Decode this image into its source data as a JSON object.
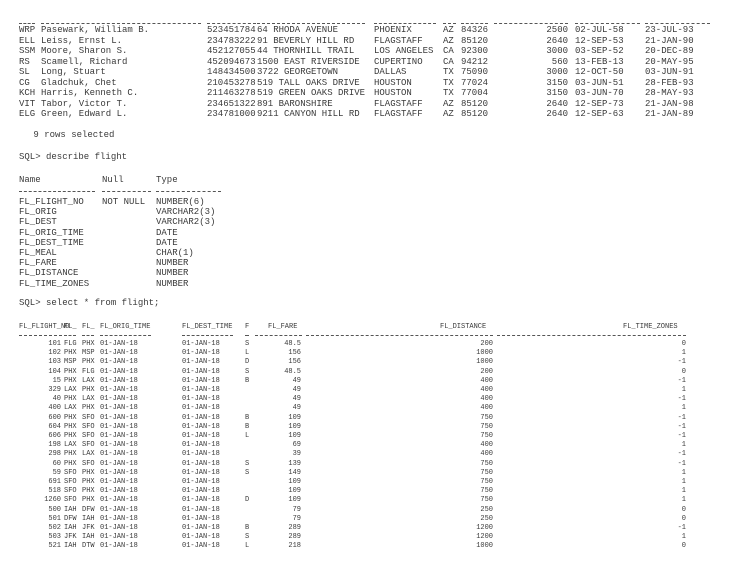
{
  "employees": {
    "rows": [
      [
        "WRP",
        "Pasewark, William B.",
        "523451784",
        "64 RHODA AVENUE",
        "PHOENIX",
        "AZ",
        "84326",
        "2500",
        "02-JUL-58",
        "23-JUL-93"
      ],
      [
        "ELL",
        "Leiss, Ernst L.",
        "234783222",
        "91 BEVERLY HILL RD",
        "FLAGSTAFF",
        "AZ",
        "85120",
        "2640",
        "12-SEP-53",
        "21-JAN-90"
      ],
      [
        "SSM",
        "Moore, Sharon S.",
        "452127055",
        "44 THORNHILL TRAIL",
        "LOS ANGELES",
        "CA",
        "92300",
        "3000",
        "03-SEP-52",
        "20-DEC-89"
      ],
      [
        "RS",
        "Scamell, Richard",
        "452094673",
        "1500 EAST RIVERSIDE",
        "CUPERTINO",
        "CA",
        "94212",
        "560",
        "13-FEB-13",
        "20-MAY-95"
      ],
      [
        "SL",
        "Long, Stuart",
        "148434500",
        "3722 GEORGETOWN",
        "DALLAS",
        "TX",
        "75090",
        "3000",
        "12-OCT-50",
        "03-JUN-91"
      ],
      [
        "CG",
        "Gladchuk, Chet",
        "210453278",
        "519 TALL OAKS DRIVE",
        "HOUSTON",
        "TX",
        "77024",
        "3150",
        "03-JUN-51",
        "28-FEB-93"
      ],
      [
        "KCH",
        "Harris, Kenneth C.",
        "211463278",
        "519 GREEN OAKS DRIVE",
        "HOUSTON",
        "TX",
        "77004",
        "3150",
        "03-JUN-70",
        "28-MAY-93"
      ],
      [
        "VIT",
        "Tabor, Victor T.",
        "234651322",
        "891 BARONSHIRE",
        "FLAGSTAFF",
        "AZ",
        "85120",
        "2640",
        "12-SEP-73",
        "21-JAN-98"
      ],
      [
        "ELG",
        "Green, Edward L.",
        "234781000",
        "9211 CANYON HILL RD",
        "FLAGSTAFF",
        "AZ",
        "85120",
        "2640",
        "12-SEP-63",
        "21-JAN-89"
      ]
    ],
    "rows_selected": " 9 rows selected"
  },
  "describe": {
    "command": "SQL> describe flight",
    "headers": [
      "Name",
      "Null",
      "Type"
    ],
    "rows": [
      [
        "FL_FLIGHT_NO",
        "NOT NULL",
        "NUMBER(6)"
      ],
      [
        "FL_ORIG",
        "",
        "VARCHAR2(3)"
      ],
      [
        "FL_DEST",
        "",
        "VARCHAR2(3)"
      ],
      [
        "FL_ORIG_TIME",
        "",
        "DATE"
      ],
      [
        "FL_DEST_TIME",
        "",
        "DATE"
      ],
      [
        "FL_MEAL",
        "",
        "CHAR(1)"
      ],
      [
        "FL_FARE",
        "",
        "NUMBER"
      ],
      [
        "FL_DISTANCE",
        "",
        "NUMBER"
      ],
      [
        "FL_TIME_ZONES",
        "",
        "NUMBER"
      ]
    ],
    "next_command": "SQL> select * from flight;"
  },
  "flights": {
    "headers": [
      "FL_FLIGHT_NO",
      "FL_",
      "FL_",
      "FL_ORIG_TIME",
      "FL_DEST_TIME",
      "F",
      "FL_FARE",
      "FL_DISTANCE",
      "FL_TIME_ZONES"
    ],
    "rows": [
      [
        "101",
        "FLG",
        "PHX",
        "01-JAN-18",
        "01-JAN-18",
        "S",
        "48.5",
        "200",
        "0"
      ],
      [
        "102",
        "PHX",
        "MSP",
        "01-JAN-18",
        "01-JAN-18",
        "L",
        "156",
        "1000",
        "1"
      ],
      [
        "103",
        "MSP",
        "PHX",
        "01-JAN-18",
        "01-JAN-18",
        "D",
        "156",
        "1000",
        "-1"
      ],
      [
        "104",
        "PHX",
        "FLG",
        "01-JAN-18",
        "01-JAN-18",
        "S",
        "48.5",
        "200",
        "0"
      ],
      [
        "15",
        "PHX",
        "LAX",
        "01-JAN-18",
        "01-JAN-18",
        "B",
        "49",
        "400",
        "-1"
      ],
      [
        "329",
        "LAX",
        "PHX",
        "01-JAN-18",
        "01-JAN-18",
        "",
        "49",
        "400",
        "1"
      ],
      [
        "40",
        "PHX",
        "LAX",
        "01-JAN-18",
        "01-JAN-18",
        "",
        "49",
        "400",
        "-1"
      ],
      [
        "400",
        "LAX",
        "PHX",
        "01-JAN-18",
        "01-JAN-18",
        "",
        "49",
        "400",
        "1"
      ],
      [
        "600",
        "PHX",
        "SFO",
        "01-JAN-18",
        "01-JAN-18",
        "B",
        "109",
        "750",
        "-1"
      ],
      [
        "604",
        "PHX",
        "SFO",
        "01-JAN-18",
        "01-JAN-18",
        "B",
        "109",
        "750",
        "-1"
      ],
      [
        "606",
        "PHX",
        "SFO",
        "01-JAN-18",
        "01-JAN-18",
        "L",
        "109",
        "750",
        "-1"
      ],
      [
        "198",
        "LAX",
        "SFO",
        "01-JAN-18",
        "01-JAN-18",
        "",
        "69",
        "400",
        "1"
      ],
      [
        "298",
        "PHX",
        "LAX",
        "01-JAN-18",
        "01-JAN-18",
        "",
        "39",
        "400",
        "-1"
      ],
      [
        "60",
        "PHX",
        "SFO",
        "01-JAN-18",
        "01-JAN-18",
        "S",
        "139",
        "750",
        "-1"
      ],
      [
        "59",
        "SFO",
        "PHX",
        "01-JAN-18",
        "01-JAN-18",
        "S",
        "149",
        "750",
        "1"
      ],
      [
        "691",
        "SFO",
        "PHX",
        "01-JAN-18",
        "01-JAN-18",
        "",
        "109",
        "750",
        "1"
      ],
      [
        "518",
        "SFO",
        "PHX",
        "01-JAN-18",
        "01-JAN-18",
        "",
        "109",
        "750",
        "1"
      ],
      [
        "1260",
        "SFO",
        "PHX",
        "01-JAN-18",
        "01-JAN-18",
        "D",
        "109",
        "750",
        "1"
      ],
      [
        "500",
        "IAH",
        "DFW",
        "01-JAN-18",
        "01-JAN-18",
        "",
        "79",
        "250",
        "0"
      ],
      [
        "501",
        "DFW",
        "IAH",
        "01-JAN-18",
        "01-JAN-18",
        "",
        "79",
        "250",
        "0"
      ],
      [
        "502",
        "IAH",
        "JFK",
        "01-JAN-18",
        "01-JAN-18",
        "B",
        "289",
        "1200",
        "-1"
      ],
      [
        "503",
        "JFK",
        "IAH",
        "01-JAN-18",
        "01-JAN-18",
        "S",
        "289",
        "1200",
        "1"
      ],
      [
        "521",
        "IAH",
        "DTW",
        "01-JAN-18",
        "01-JAN-18",
        "L",
        "218",
        "1000",
        "0"
      ]
    ]
  }
}
